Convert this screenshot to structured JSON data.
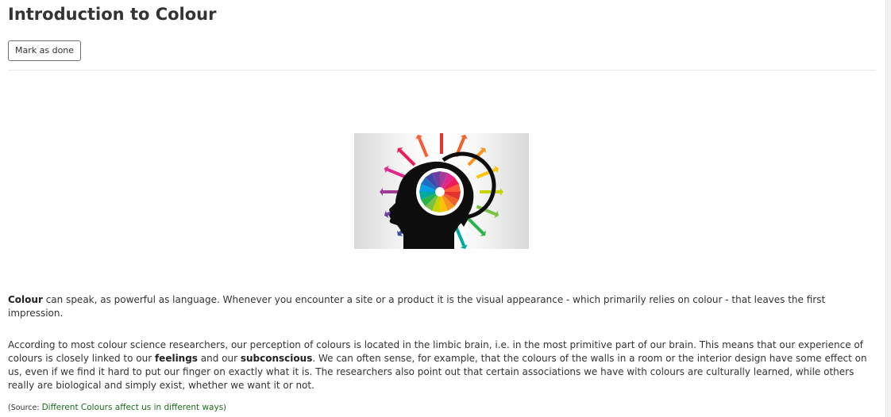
{
  "page": {
    "title": "Introduction to Colour",
    "mark_done_label": "Mark as done"
  },
  "image": {
    "icon": "colour-head-arrows-illustration"
  },
  "paragraph1": {
    "bold_lead": "Colour",
    "text": " can speak, as powerful as language. Whenever you encounter a site or a product it is the visual appearance - which primarily relies on colour - that leaves the first impression."
  },
  "paragraph2": {
    "part1": "According to most colour science researchers, our perception of colours is located in the limbic brain, i.e. in the most primitive part of our brain. This means that our experience of colours is closely linked to our ",
    "bold1": "feelings",
    "part2": " and our ",
    "bold2": "subconscious",
    "part3": ". We can often sense, for example, that the colours of the walls in a room or the interior design have some effect on us, even if we find it hard to put our finger on exactly what it is. The researchers also point out that certain associations we have with colours are culturally learned, while others really are biological and simply exist, whether we want it or not."
  },
  "source": {
    "prefix": "(Source: ",
    "link_text": "Different Colours affect us in different ways",
    "suffix": ")"
  },
  "colors": {
    "link": "#1a6b1a",
    "text": "#333333",
    "border": "#6f6f6f"
  }
}
